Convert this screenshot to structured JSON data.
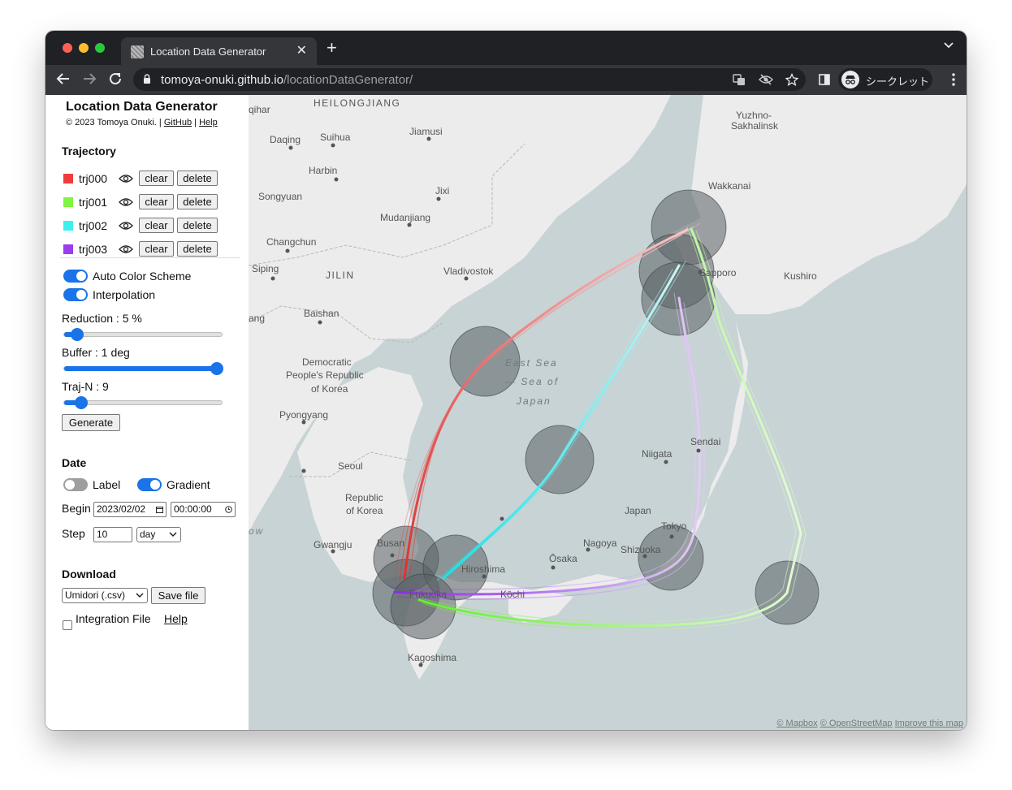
{
  "browser": {
    "tab_title": "Location Data Generator",
    "url_host": "tomoya-onuki.github.io",
    "url_path": "/locationDataGenerator/",
    "incognito_label": "シークレット"
  },
  "app": {
    "title": "Location Data Generator",
    "copyright": "© 2023 Tomoya Onuki.",
    "sep1": "|",
    "github_link": "GitHub",
    "sep2": "|",
    "help_link": "Help"
  },
  "trajectory": {
    "heading": "Trajectory",
    "clear_label": "clear",
    "delete_label": "delete",
    "items": [
      {
        "name": "trj000",
        "color": "#f03c3c"
      },
      {
        "name": "trj001",
        "color": "#7ef542"
      },
      {
        "name": "trj002",
        "color": "#3cf0f0"
      },
      {
        "name": "trj003",
        "color": "#9b3cf0"
      }
    ]
  },
  "settings": {
    "auto_color_label": "Auto Color Scheme",
    "auto_color_on": true,
    "interpolation_label": "Interpolation",
    "interpolation_on": true,
    "reduction_label": "Reduction : 5 %",
    "reduction_value": 0.08,
    "buffer_label": "Buffer : 1 deg",
    "buffer_value": 0.97,
    "trajn_label": "Traj-N : 9",
    "trajn_value": 0.11,
    "generate_label": "Generate"
  },
  "date": {
    "heading": "Date",
    "label_toggle": "Label",
    "label_on": false,
    "gradient_toggle": "Gradient",
    "gradient_on": true,
    "begin_label": "Begin",
    "begin_date": "2023/02/02",
    "begin_time": "00:00:00",
    "step_label": "Step",
    "step_value": "10",
    "step_unit": "day"
  },
  "download": {
    "heading": "Download",
    "format": "Umidori (.csv)",
    "save_label": "Save file",
    "integration_label": "Integration File",
    "help_label": "Help"
  },
  "map": {
    "labels": {
      "heilongjiang": "HEILONGJIANG",
      "qiqihar": "qihar",
      "daqing": "Daqing",
      "suihua": "Suihua",
      "jiamusi": "Jiamusi",
      "yuzhno": "Yuzhno-",
      "sakhalinsk": "Sakhalinsk",
      "wakkanai": "Wakkanai",
      "harbin": "Harbin",
      "songyuan": "Songyuan",
      "jixi": "Jixi",
      "mudanjiang": "Mudanjiang",
      "changchun": "Changchun",
      "siping": "Siping",
      "vladivostok": "Vladivostok",
      "jilin": "JILIN",
      "sapporo": "Sapporo",
      "kushiro": "Kushiro",
      "baishan": "Baishan",
      "yang": "ang",
      "east_sea": "East Sea",
      "sea_of": "— Sea of",
      "japan_sea": "Japan",
      "dprk1": "Democratic",
      "dprk2": "People's Republic",
      "dprk3": "of Korea",
      "pyongyang": "Pyongyang",
      "niigata": "Niigata",
      "sendai": "Sendai",
      "seoul": "Seoul",
      "rok1": "Republic",
      "rok2": "of Korea",
      "japan": "Japan",
      "tokyo": "Tokyo",
      "gwangju": "Gwangju",
      "busan": "Busan",
      "nagoya": "Nagoya",
      "hiroshima": "Hiroshima",
      "osaka": "Ōsaka",
      "shizuoka": "Shizuoka",
      "fukuoka": "Fukuoka",
      "kochi": "Kōchi",
      "kagoshima": "Kagoshima",
      "yellow_sea": "ow"
    },
    "attribution": {
      "mapbox": "© Mapbox",
      "osm": "© OpenStreetMap",
      "improve": "Improve this map"
    }
  },
  "colors": {
    "accent": "#1a73e8",
    "land": "#ececec",
    "water": "#c8d3d5",
    "chrome_dark": "#202124",
    "chrome_tab": "#35363a"
  }
}
